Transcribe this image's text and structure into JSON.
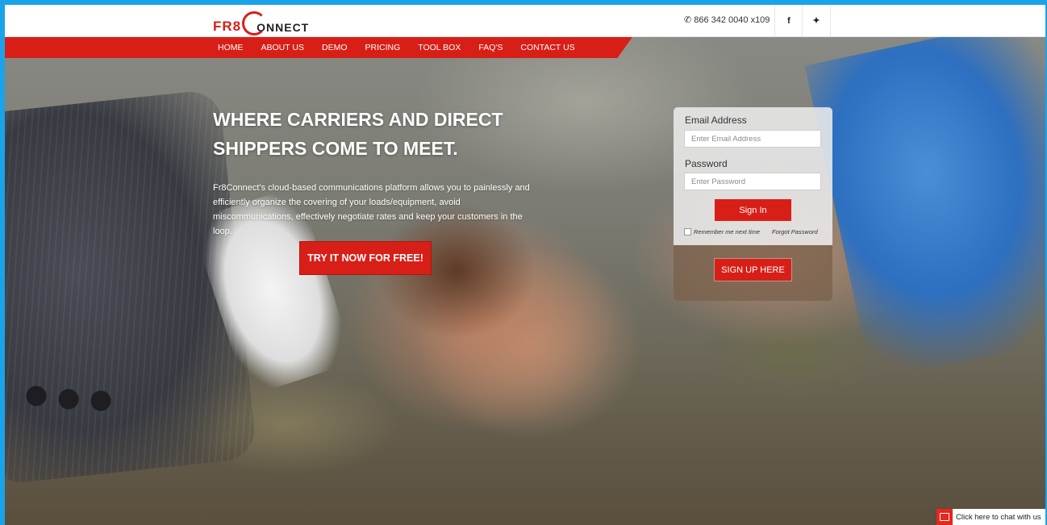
{
  "brand": {
    "logo_part1": "FR8",
    "logo_part2": "ONNECT"
  },
  "header": {
    "phone": "866 342 0040 x109",
    "phone_icon": "phone-icon",
    "facebook_glyph": "f",
    "twitter_glyph": "✦"
  },
  "nav": {
    "items": [
      {
        "label": "HOME"
      },
      {
        "label": "ABOUT US"
      },
      {
        "label": "DEMO"
      },
      {
        "label": "PRICING"
      },
      {
        "label": "TOOL BOX"
      },
      {
        "label": "FAQ'S"
      },
      {
        "label": "CONTACT US"
      }
    ]
  },
  "hero": {
    "headline": "WHERE CARRIERS AND DIRECT SHIPPERS COME TO MEET.",
    "blurb": "Fr8Connect's cloud-based communications platform allows you to painlessly and efficiently organize the covering of your loads/equipment, avoid miscommunications, effectively negotiate rates and keep your customers in the loop.",
    "cta_label": "TRY IT NOW FOR FREE!"
  },
  "login": {
    "email_label": "Email Address",
    "email_placeholder": "Enter Email Address",
    "email_value": "",
    "password_label": "Password",
    "password_placeholder": "Enter Password",
    "password_value": "",
    "signin_label": "Sign In",
    "remember_label": "Remember me next time",
    "remember_checked": false,
    "forgot_label": "Forgot Password",
    "signup_label": "SIGN UP HERE"
  },
  "chat": {
    "label": "Click here to chat with us"
  },
  "colors": {
    "brand_red": "#d81f17",
    "frame_blue": "#1aa3e8"
  }
}
